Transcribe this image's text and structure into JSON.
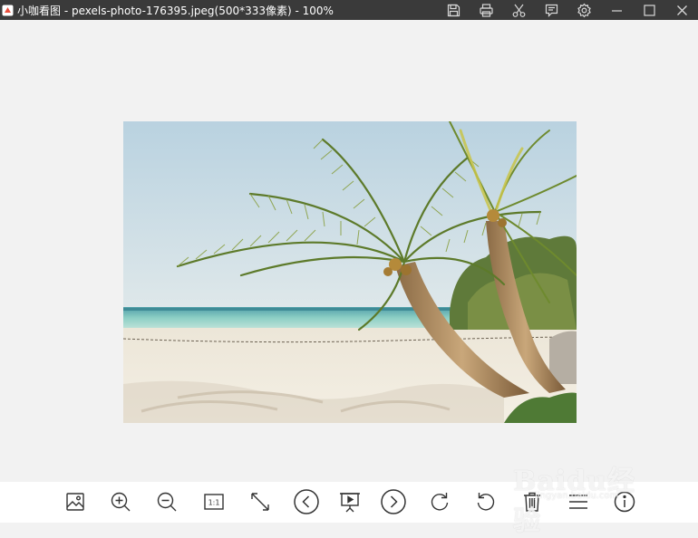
{
  "window": {
    "title": "小咖看图 - pexels-photo-176395.jpeg(500*333像素) - 100%",
    "title_bar_color": "#3a3a3a",
    "logo_color": "#e94e3c",
    "controls": [
      "save-icon",
      "print-icon",
      "cut-icon",
      "feedback-icon",
      "settings-icon",
      "minimize-icon",
      "maximize-icon",
      "close-icon"
    ]
  },
  "viewer": {
    "background": "#f2f2f2",
    "image_name": "pexels-photo-176395.jpeg",
    "image_size": "500*333"
  },
  "toolbar": {
    "tools": [
      "image-icon",
      "zoom-in-icon",
      "zoom-out-icon",
      "actual-size-icon",
      "fit-screen-icon",
      "previous-icon",
      "slideshow-icon",
      "next-icon",
      "rotate-right-icon",
      "rotate-left-icon",
      "delete-icon",
      "menu-icon",
      "info-icon"
    ],
    "actual_size_label": "1:1"
  },
  "watermark": {
    "text": "Baidu经验",
    "url": "jingyan.baidu.com"
  }
}
